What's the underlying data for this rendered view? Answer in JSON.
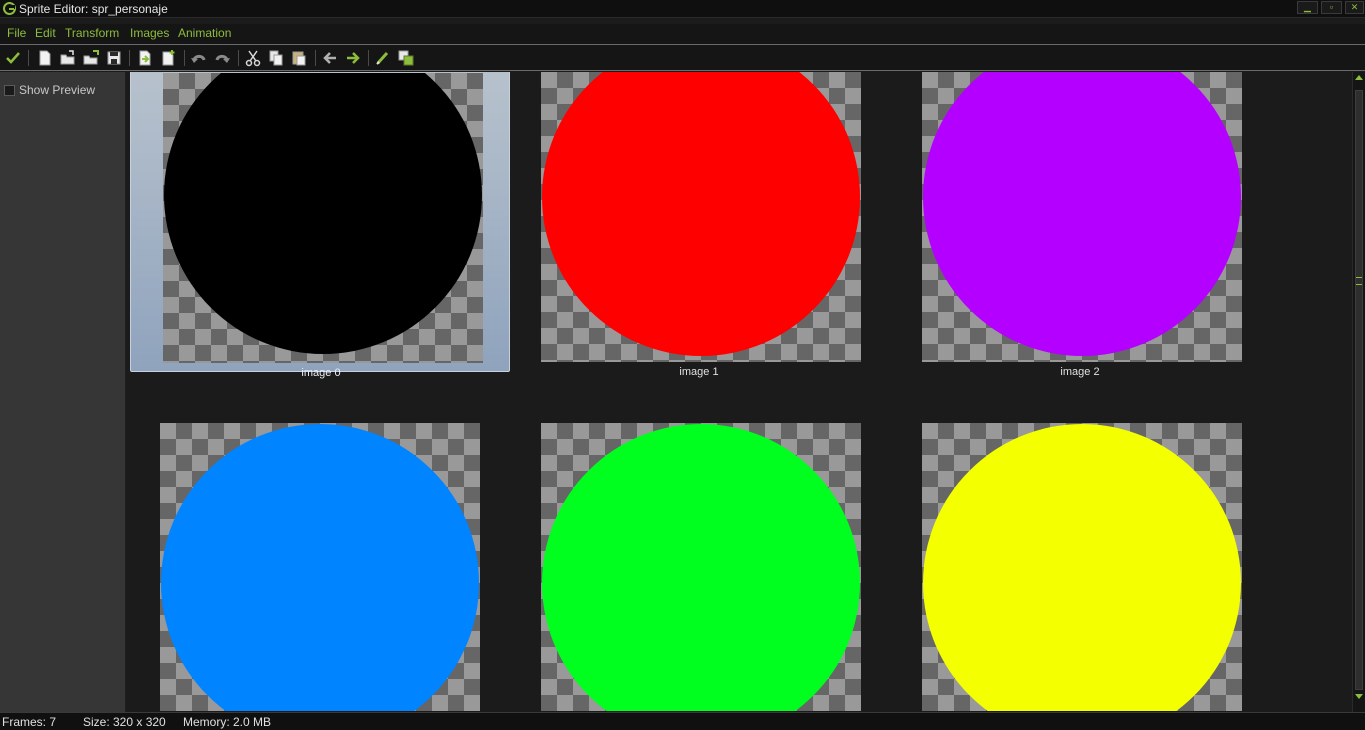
{
  "window": {
    "title": "Sprite Editor: spr_personaje",
    "minimize_label": "▁",
    "restore_label": "▫",
    "close_label": "✕"
  },
  "menu": {
    "items": [
      {
        "label": "File"
      },
      {
        "label": "Edit"
      },
      {
        "label": "Transform"
      },
      {
        "label": "Images"
      },
      {
        "label": "Animation"
      }
    ]
  },
  "toolbar": {
    "buttons": [
      "confirm-icon",
      "new-icon",
      "open-icon",
      "open-add-icon",
      "save-icon",
      "import-icon",
      "new-frame-icon",
      "undo-icon",
      "redo-icon",
      "cut-icon",
      "copy-icon",
      "paste-icon",
      "move-left-icon",
      "move-right-icon",
      "edit-icon",
      "layers-icon"
    ],
    "accent": "#8dbd3c"
  },
  "left_panel": {
    "show_preview_label": "Show Preview",
    "show_preview_checked": false
  },
  "frames": [
    {
      "label": "image 0",
      "color": "#000000",
      "selected": true
    },
    {
      "label": "image 1",
      "color": "#ff0000",
      "selected": false
    },
    {
      "label": "image 2",
      "color": "#b400ff",
      "selected": false
    },
    {
      "label": "",
      "color": "#0084ff",
      "selected": false
    },
    {
      "label": "",
      "color": "#00ff1e",
      "selected": false
    },
    {
      "label": "",
      "color": "#f4ff00",
      "selected": false
    }
  ],
  "status": {
    "frames": "Frames: 7",
    "size": "Size: 320 x 320",
    "memory": "Memory: 2.0 MB"
  }
}
